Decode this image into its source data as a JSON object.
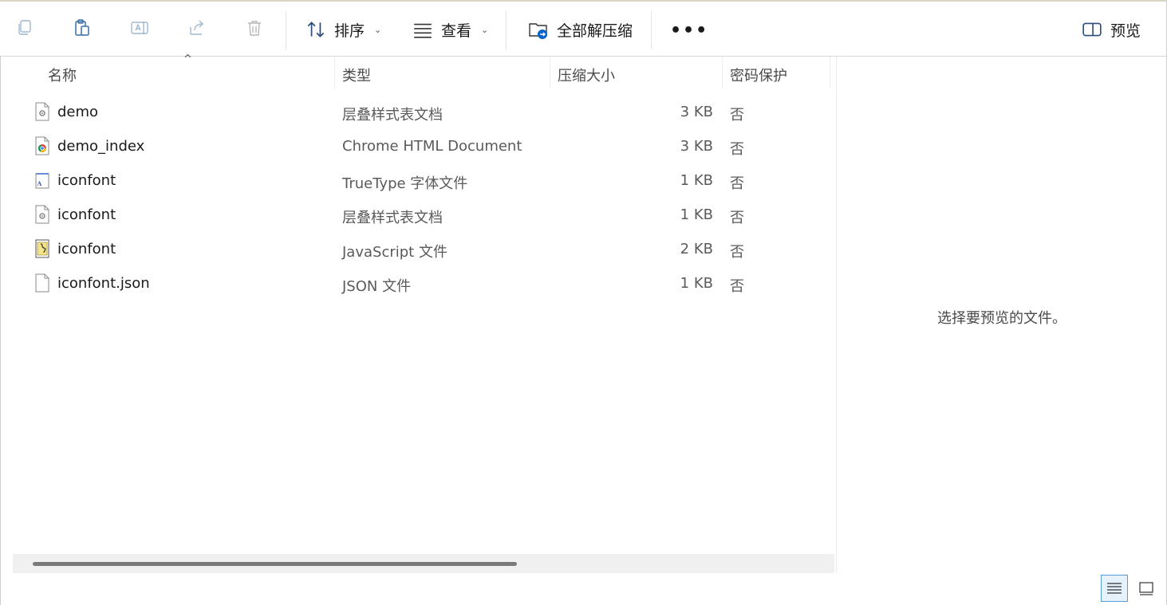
{
  "toolbar": {
    "sort_label": "排序",
    "view_label": "查看",
    "extract_all_label": "全部解压缩",
    "more_label": "•••",
    "preview_label": "预览",
    "icons": [
      "copy-icon",
      "paste-icon",
      "rename-icon",
      "share-icon",
      "delete-icon",
      "sort-icon",
      "view-icon",
      "extract-icon",
      "preview-pane-icon"
    ],
    "accent": "#0a64c8"
  },
  "columns": {
    "name": "名称",
    "type": "类型",
    "compressed_size": "压缩大小",
    "password": "密码保护"
  },
  "files": [
    {
      "name": "demo",
      "type": "层叠样式表文档",
      "size": "3 KB",
      "password": "否",
      "icon": "css-file-icon"
    },
    {
      "name": "demo_index",
      "type": "Chrome HTML Document",
      "size": "3 KB",
      "password": "否",
      "icon": "chrome-html-icon"
    },
    {
      "name": "iconfont",
      "type": "TrueType 字体文件",
      "size": "1 KB",
      "password": "否",
      "icon": "font-file-icon"
    },
    {
      "name": "iconfont",
      "type": "层叠样式表文档",
      "size": "1 KB",
      "password": "否",
      "icon": "css-file-icon"
    },
    {
      "name": "iconfont",
      "type": "JavaScript 文件",
      "size": "2 KB",
      "password": "否",
      "icon": "js-file-icon"
    },
    {
      "name": "iconfont.json",
      "type": "JSON 文件",
      "size": "1 KB",
      "password": "否",
      "icon": "blank-file-icon"
    }
  ],
  "preview": {
    "message": "选择要预览的文件。"
  },
  "statusbar": {
    "active_view": "details"
  }
}
